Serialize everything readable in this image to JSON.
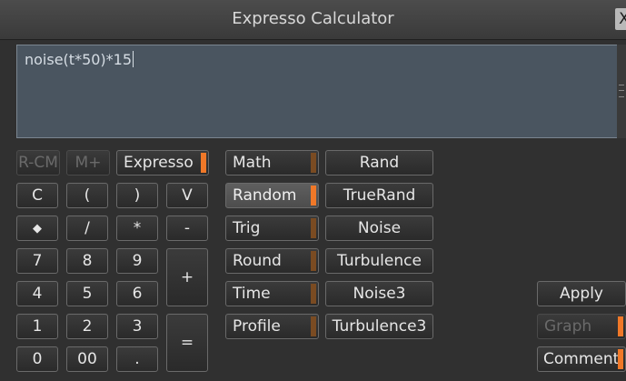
{
  "window": {
    "title": "Expresso Calculator",
    "close_label": "X"
  },
  "editor": {
    "text": "noise(t*50)*15"
  },
  "keypad": {
    "memory": [
      "R-CM",
      "M+"
    ],
    "mode_label": "Expresso",
    "row1": [
      "C",
      "(",
      ")",
      "V"
    ],
    "row2": [
      "◆",
      "/",
      "*",
      "-"
    ],
    "row3": [
      "7",
      "8",
      "9"
    ],
    "row4": [
      "4",
      "5",
      "6"
    ],
    "row5": [
      "1",
      "2",
      "3"
    ],
    "row6": [
      "0",
      "00",
      "."
    ],
    "plus": "+",
    "equals": "="
  },
  "categories": [
    "Math",
    "Random",
    "Trig",
    "Round",
    "Time",
    "Profile"
  ],
  "selected_category": "Random",
  "functions": [
    "Rand",
    "TrueRand",
    "Noise",
    "Turbulence",
    "Noise3",
    "Turbulence3"
  ],
  "actions": {
    "apply": "Apply",
    "graph": "Graph",
    "comment": "Comment"
  },
  "colors": {
    "accent": "#f07828",
    "accent_dim": "#7a4b22",
    "editor_bg": "#4a5560"
  }
}
